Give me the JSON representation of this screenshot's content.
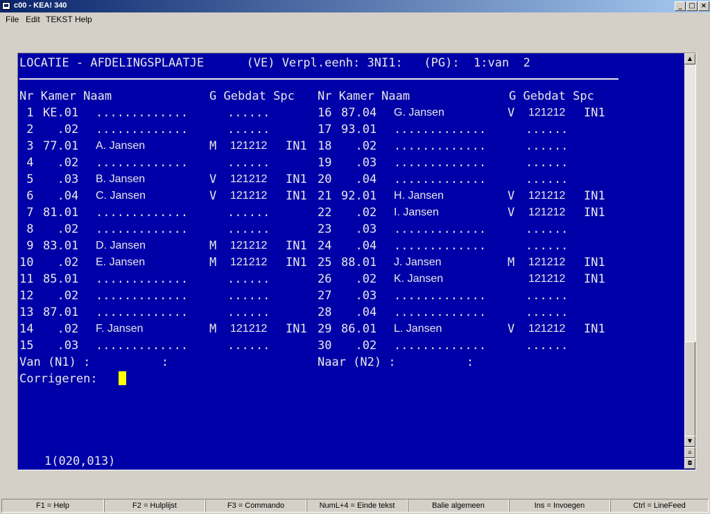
{
  "window": {
    "title": "c00 - KEA! 340",
    "min": "_",
    "max": "□",
    "close": "×"
  },
  "menu": [
    "File",
    "Edit",
    "TEKST",
    "Help"
  ],
  "screen": {
    "header": "LOCATIE - AFDELINGSPLAATJE      (VE) Verpl.eenh: 3NI1:   (PG):  1:van  2",
    "col_left": "Nr Kamer Naam",
    "col_left2": "G Gebdat Spc",
    "col_right": "Nr Kamer Naam",
    "col_right2": "G Gebdat Spc",
    "rows_left": [
      {
        "nr": " 1",
        "kamer": "KE.01",
        "naam": "",
        "g": "",
        "geb": "",
        "spc": ""
      },
      {
        "nr": " 2",
        "kamer": "  .02",
        "naam": "",
        "g": "",
        "geb": "",
        "spc": ""
      },
      {
        "nr": " 3",
        "kamer": "77.01",
        "naam": "A. Jansen",
        "g": "M",
        "geb": "121212",
        "spc": "IN1"
      },
      {
        "nr": " 4",
        "kamer": "  .02",
        "naam": "",
        "g": "",
        "geb": "",
        "spc": ""
      },
      {
        "nr": " 5",
        "kamer": "  .03",
        "naam": "B. Jansen",
        "g": "V",
        "geb": "121212",
        "spc": "IN1"
      },
      {
        "nr": " 6",
        "kamer": "  .04",
        "naam": "C. Jansen",
        "g": "V",
        "geb": "121212",
        "spc": "IN1"
      },
      {
        "nr": " 7",
        "kamer": "81.01",
        "naam": "",
        "g": "",
        "geb": "",
        "spc": ""
      },
      {
        "nr": " 8",
        "kamer": "  .02",
        "naam": "",
        "g": "",
        "geb": "",
        "spc": ""
      },
      {
        "nr": " 9",
        "kamer": "83.01",
        "naam": "D. Jansen",
        "g": "M",
        "geb": "121212",
        "spc": "IN1"
      },
      {
        "nr": "10",
        "kamer": "  .02",
        "naam": "E. Jansen",
        "g": "M",
        "geb": "121212",
        "spc": "IN1"
      },
      {
        "nr": "11",
        "kamer": "85.01",
        "naam": "",
        "g": "",
        "geb": "",
        "spc": ""
      },
      {
        "nr": "12",
        "kamer": "  .02",
        "naam": "",
        "g": "",
        "geb": "",
        "spc": ""
      },
      {
        "nr": "13",
        "kamer": "87.01",
        "naam": "",
        "g": "",
        "geb": "",
        "spc": ""
      },
      {
        "nr": "14",
        "kamer": "  .02",
        "naam": "F. Jansen",
        "g": "M",
        "geb": "121212",
        "spc": "IN1"
      },
      {
        "nr": "15",
        "kamer": "  .03",
        "naam": "",
        "g": "",
        "geb": "",
        "spc": ""
      }
    ],
    "rows_right": [
      {
        "nr": "16",
        "kamer": "87.04",
        "naam": "G. Jansen",
        "g": "V",
        "geb": "121212",
        "spc": "IN1"
      },
      {
        "nr": "17",
        "kamer": "93.01",
        "naam": "",
        "g": "",
        "geb": "",
        "spc": ""
      },
      {
        "nr": "18",
        "kamer": "  .02",
        "naam": "",
        "g": "",
        "geb": "",
        "spc": ""
      },
      {
        "nr": "19",
        "kamer": "  .03",
        "naam": "",
        "g": "",
        "geb": "",
        "spc": ""
      },
      {
        "nr": "20",
        "kamer": "  .04",
        "naam": "",
        "g": "",
        "geb": "",
        "spc": ""
      },
      {
        "nr": "21",
        "kamer": "92.01",
        "naam": "H. Jansen",
        "g": "V",
        "geb": "121212",
        "spc": "IN1"
      },
      {
        "nr": "22",
        "kamer": "  .02",
        "naam": "I. Jansen",
        "g": "V",
        "geb": "121212",
        "spc": "IN1"
      },
      {
        "nr": "23",
        "kamer": "  .03",
        "naam": "",
        "g": "",
        "geb": "",
        "spc": ""
      },
      {
        "nr": "24",
        "kamer": "  .04",
        "naam": "",
        "g": "",
        "geb": "",
        "spc": ""
      },
      {
        "nr": "25",
        "kamer": "88.01",
        "naam": "J. Jansen",
        "g": "M",
        "geb": "121212",
        "spc": "IN1"
      },
      {
        "nr": "26",
        "kamer": "  .02",
        "naam": "K. Jansen",
        "g": "",
        "geb": "121212",
        "spc": "IN1"
      },
      {
        "nr": "27",
        "kamer": "  .03",
        "naam": "",
        "g": "",
        "geb": "",
        "spc": ""
      },
      {
        "nr": "28",
        "kamer": "  .04",
        "naam": "",
        "g": "",
        "geb": "",
        "spc": ""
      },
      {
        "nr": "29",
        "kamer": "86.01",
        "naam": "L. Jansen",
        "g": "V",
        "geb": "121212",
        "spc": "IN1"
      },
      {
        "nr": "30",
        "kamer": "  .02",
        "naam": "",
        "g": "",
        "geb": "",
        "spc": ""
      }
    ],
    "placeholder_name": ".............",
    "placeholder_geb": "......",
    "van_label": "Van (N1) :          :",
    "naar_label": "Naar (N2) :          :",
    "corrigeren_label": "Corrigeren:"
  },
  "status_position": "1(020,013)",
  "fkeys": [
    "F1 = Help",
    "F2 = Hulplijst",
    "F3 = Commando",
    "NumL+4 = Einde tekst",
    "Balie algemeen",
    "Ins = Invoegen",
    "Ctrl = LineFeed"
  ],
  "colors": {
    "screen_bg": "#0000a8",
    "text": "#e8e8e8",
    "cursor": "#ffff00"
  }
}
